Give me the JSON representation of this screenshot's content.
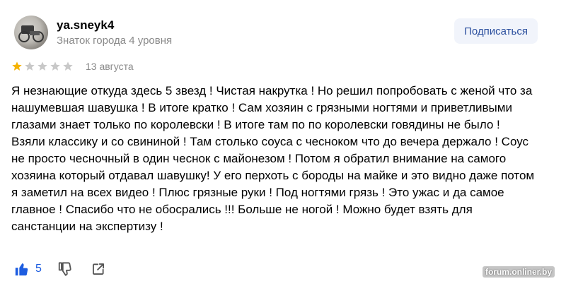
{
  "author": {
    "name": "ya.sneyk4",
    "level": "Знаток города 4 уровня"
  },
  "subscribe_label": "Подписаться",
  "rating": {
    "value": 1,
    "max": 5,
    "filled_color": "#f5b300",
    "empty_color": "#c8c8c8"
  },
  "date": "13 августа",
  "review_text": "Я незнающие откуда здесь 5 звезд ! Чистая накрутка ! Но решил попробовать с женой что за нашумевшая шавушка ! В итоге кратко ! Сам хозяин с грязными ногтями и приветливыми глазами знает только по королевски ! В итоге там по по королевски говядины не было ! Взяли классику и со свининой ! Там столько соуса с чесноком что до вечера держало ! Соус не просто чесночный в один чеснок с майонезом ! Потом я обратил внимание на самого хозяина который отдавал шавушку! У его перхоть с бороды на майке и это видно даже потом я заметил на всех видео ! Плюс грязные руки ! Под ногтями грязь ! Это ужас и да самое главное ! Спасибо что не обосрались !!! Больше не ногой ! Можно будет взять для санстанции на экспертизу !",
  "likes": {
    "count": "5",
    "color": "#1d5de0"
  },
  "icons": {
    "like": "thumbs-up-icon",
    "dislike": "thumbs-down-icon",
    "share": "share-icon"
  },
  "watermark": "forum.onliner.by"
}
